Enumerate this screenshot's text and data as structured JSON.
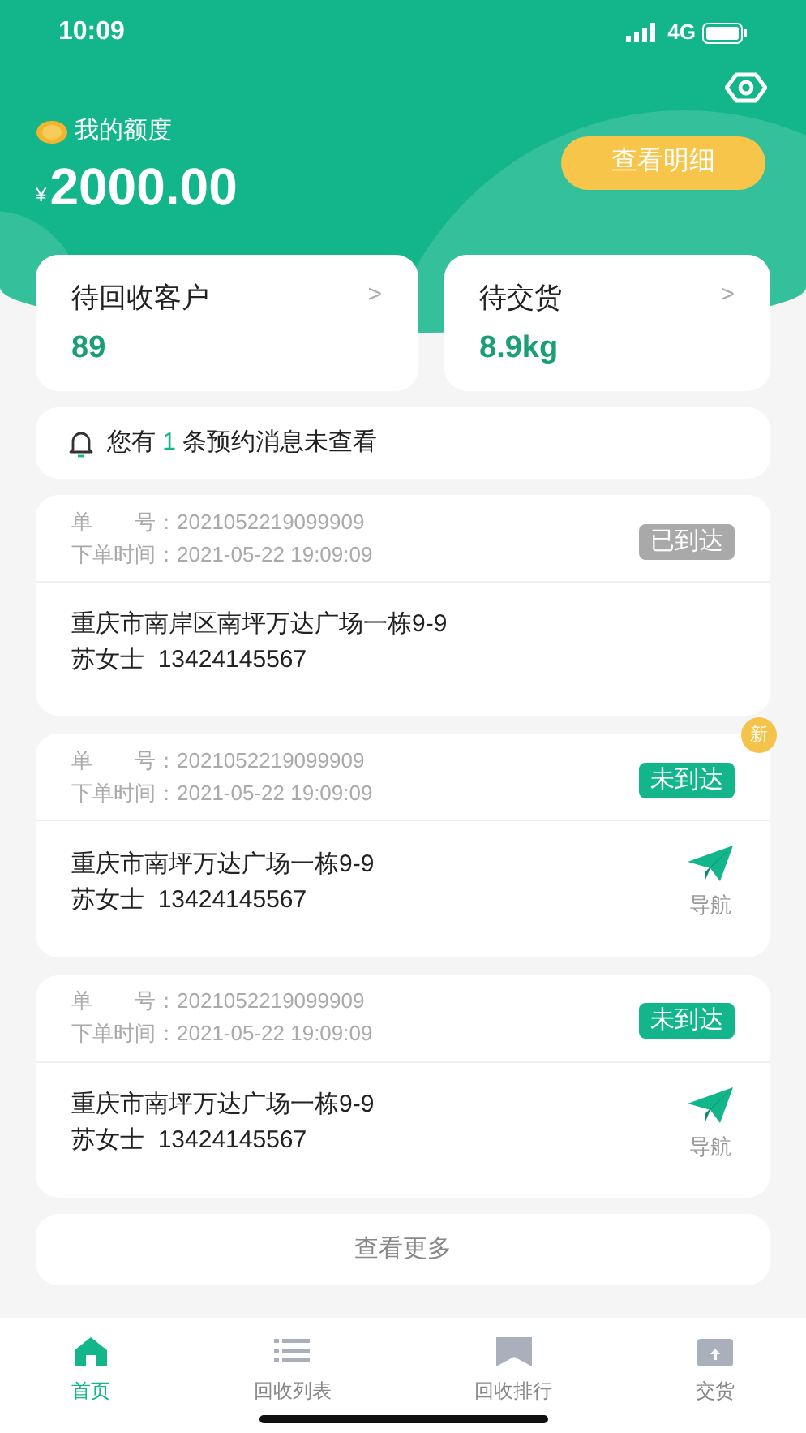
{
  "status_bar": {
    "time": "10:09",
    "network": "4G"
  },
  "balance": {
    "label": "我的额度",
    "currency": "¥",
    "amount": "2000.00",
    "detail_button": "查看明细"
  },
  "stats": [
    {
      "label": "待回收客户",
      "value": "89",
      "arrow": ">"
    },
    {
      "label": "待交货",
      "value": "8.9kg",
      "arrow": ">"
    }
  ],
  "notice": {
    "before": "您有",
    "count": "1",
    "after": "条预约消息未查看"
  },
  "orders": [
    {
      "order_no_label": "单　　号：",
      "order_no": "2021052219099909",
      "time_label": "下单时间：",
      "time": "2021-05-22 19:09:09",
      "status": "已到达",
      "arrived": true,
      "address": "重庆市南岸区南坪万达广场一栋9-9",
      "contact": "苏女士  13424145567"
    },
    {
      "order_no_label": "单　　号：",
      "order_no": "2021052219099909",
      "time_label": "下单时间：",
      "time": "2021-05-22 19:09:09",
      "status": "未到达",
      "arrived": false,
      "new_badge": "新",
      "address": "重庆市南坪万达广场一栋9-9",
      "contact": "苏女士  13424145567",
      "nav_label": "导航"
    },
    {
      "order_no_label": "单　　号：",
      "order_no": "2021052219099909",
      "time_label": "下单时间：",
      "time": "2021-05-22 19:09:09",
      "status": "未到达",
      "arrived": false,
      "address": "重庆市南坪万达广场一栋9-9",
      "contact": "苏女士  13424145567",
      "nav_label": "导航"
    }
  ],
  "more_button": "查看更多",
  "tab_bar": [
    {
      "label": "首页",
      "kind": "home",
      "selected": true
    },
    {
      "label": "回收列表",
      "kind": "list",
      "selected": false
    },
    {
      "label": "回收排行",
      "kind": "rank",
      "selected": false
    },
    {
      "label": "交货",
      "kind": "deliver",
      "selected": false
    }
  ]
}
